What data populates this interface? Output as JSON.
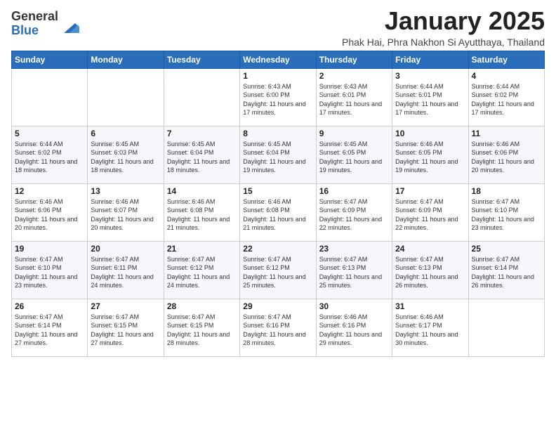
{
  "header": {
    "logo_general": "General",
    "logo_blue": "Blue",
    "month_title": "January 2025",
    "subtitle": "Phak Hai, Phra Nakhon Si Ayutthaya, Thailand"
  },
  "weekdays": [
    "Sunday",
    "Monday",
    "Tuesday",
    "Wednesday",
    "Thursday",
    "Friday",
    "Saturday"
  ],
  "weeks": [
    [
      {
        "day": "",
        "info": ""
      },
      {
        "day": "",
        "info": ""
      },
      {
        "day": "",
        "info": ""
      },
      {
        "day": "1",
        "info": "Sunrise: 6:43 AM\nSunset: 6:00 PM\nDaylight: 11 hours and 17 minutes."
      },
      {
        "day": "2",
        "info": "Sunrise: 6:43 AM\nSunset: 6:01 PM\nDaylight: 11 hours and 17 minutes."
      },
      {
        "day": "3",
        "info": "Sunrise: 6:44 AM\nSunset: 6:01 PM\nDaylight: 11 hours and 17 minutes."
      },
      {
        "day": "4",
        "info": "Sunrise: 6:44 AM\nSunset: 6:02 PM\nDaylight: 11 hours and 17 minutes."
      }
    ],
    [
      {
        "day": "5",
        "info": "Sunrise: 6:44 AM\nSunset: 6:02 PM\nDaylight: 11 hours and 18 minutes."
      },
      {
        "day": "6",
        "info": "Sunrise: 6:45 AM\nSunset: 6:03 PM\nDaylight: 11 hours and 18 minutes."
      },
      {
        "day": "7",
        "info": "Sunrise: 6:45 AM\nSunset: 6:04 PM\nDaylight: 11 hours and 18 minutes."
      },
      {
        "day": "8",
        "info": "Sunrise: 6:45 AM\nSunset: 6:04 PM\nDaylight: 11 hours and 19 minutes."
      },
      {
        "day": "9",
        "info": "Sunrise: 6:45 AM\nSunset: 6:05 PM\nDaylight: 11 hours and 19 minutes."
      },
      {
        "day": "10",
        "info": "Sunrise: 6:46 AM\nSunset: 6:05 PM\nDaylight: 11 hours and 19 minutes."
      },
      {
        "day": "11",
        "info": "Sunrise: 6:46 AM\nSunset: 6:06 PM\nDaylight: 11 hours and 20 minutes."
      }
    ],
    [
      {
        "day": "12",
        "info": "Sunrise: 6:46 AM\nSunset: 6:06 PM\nDaylight: 11 hours and 20 minutes."
      },
      {
        "day": "13",
        "info": "Sunrise: 6:46 AM\nSunset: 6:07 PM\nDaylight: 11 hours and 20 minutes."
      },
      {
        "day": "14",
        "info": "Sunrise: 6:46 AM\nSunset: 6:08 PM\nDaylight: 11 hours and 21 minutes."
      },
      {
        "day": "15",
        "info": "Sunrise: 6:46 AM\nSunset: 6:08 PM\nDaylight: 11 hours and 21 minutes."
      },
      {
        "day": "16",
        "info": "Sunrise: 6:47 AM\nSunset: 6:09 PM\nDaylight: 11 hours and 22 minutes."
      },
      {
        "day": "17",
        "info": "Sunrise: 6:47 AM\nSunset: 6:09 PM\nDaylight: 11 hours and 22 minutes."
      },
      {
        "day": "18",
        "info": "Sunrise: 6:47 AM\nSunset: 6:10 PM\nDaylight: 11 hours and 23 minutes."
      }
    ],
    [
      {
        "day": "19",
        "info": "Sunrise: 6:47 AM\nSunset: 6:10 PM\nDaylight: 11 hours and 23 minutes."
      },
      {
        "day": "20",
        "info": "Sunrise: 6:47 AM\nSunset: 6:11 PM\nDaylight: 11 hours and 24 minutes."
      },
      {
        "day": "21",
        "info": "Sunrise: 6:47 AM\nSunset: 6:12 PM\nDaylight: 11 hours and 24 minutes."
      },
      {
        "day": "22",
        "info": "Sunrise: 6:47 AM\nSunset: 6:12 PM\nDaylight: 11 hours and 25 minutes."
      },
      {
        "day": "23",
        "info": "Sunrise: 6:47 AM\nSunset: 6:13 PM\nDaylight: 11 hours and 25 minutes."
      },
      {
        "day": "24",
        "info": "Sunrise: 6:47 AM\nSunset: 6:13 PM\nDaylight: 11 hours and 26 minutes."
      },
      {
        "day": "25",
        "info": "Sunrise: 6:47 AM\nSunset: 6:14 PM\nDaylight: 11 hours and 26 minutes."
      }
    ],
    [
      {
        "day": "26",
        "info": "Sunrise: 6:47 AM\nSunset: 6:14 PM\nDaylight: 11 hours and 27 minutes."
      },
      {
        "day": "27",
        "info": "Sunrise: 6:47 AM\nSunset: 6:15 PM\nDaylight: 11 hours and 27 minutes."
      },
      {
        "day": "28",
        "info": "Sunrise: 6:47 AM\nSunset: 6:15 PM\nDaylight: 11 hours and 28 minutes."
      },
      {
        "day": "29",
        "info": "Sunrise: 6:47 AM\nSunset: 6:16 PM\nDaylight: 11 hours and 28 minutes."
      },
      {
        "day": "30",
        "info": "Sunrise: 6:46 AM\nSunset: 6:16 PM\nDaylight: 11 hours and 29 minutes."
      },
      {
        "day": "31",
        "info": "Sunrise: 6:46 AM\nSunset: 6:17 PM\nDaylight: 11 hours and 30 minutes."
      },
      {
        "day": "",
        "info": ""
      }
    ]
  ]
}
